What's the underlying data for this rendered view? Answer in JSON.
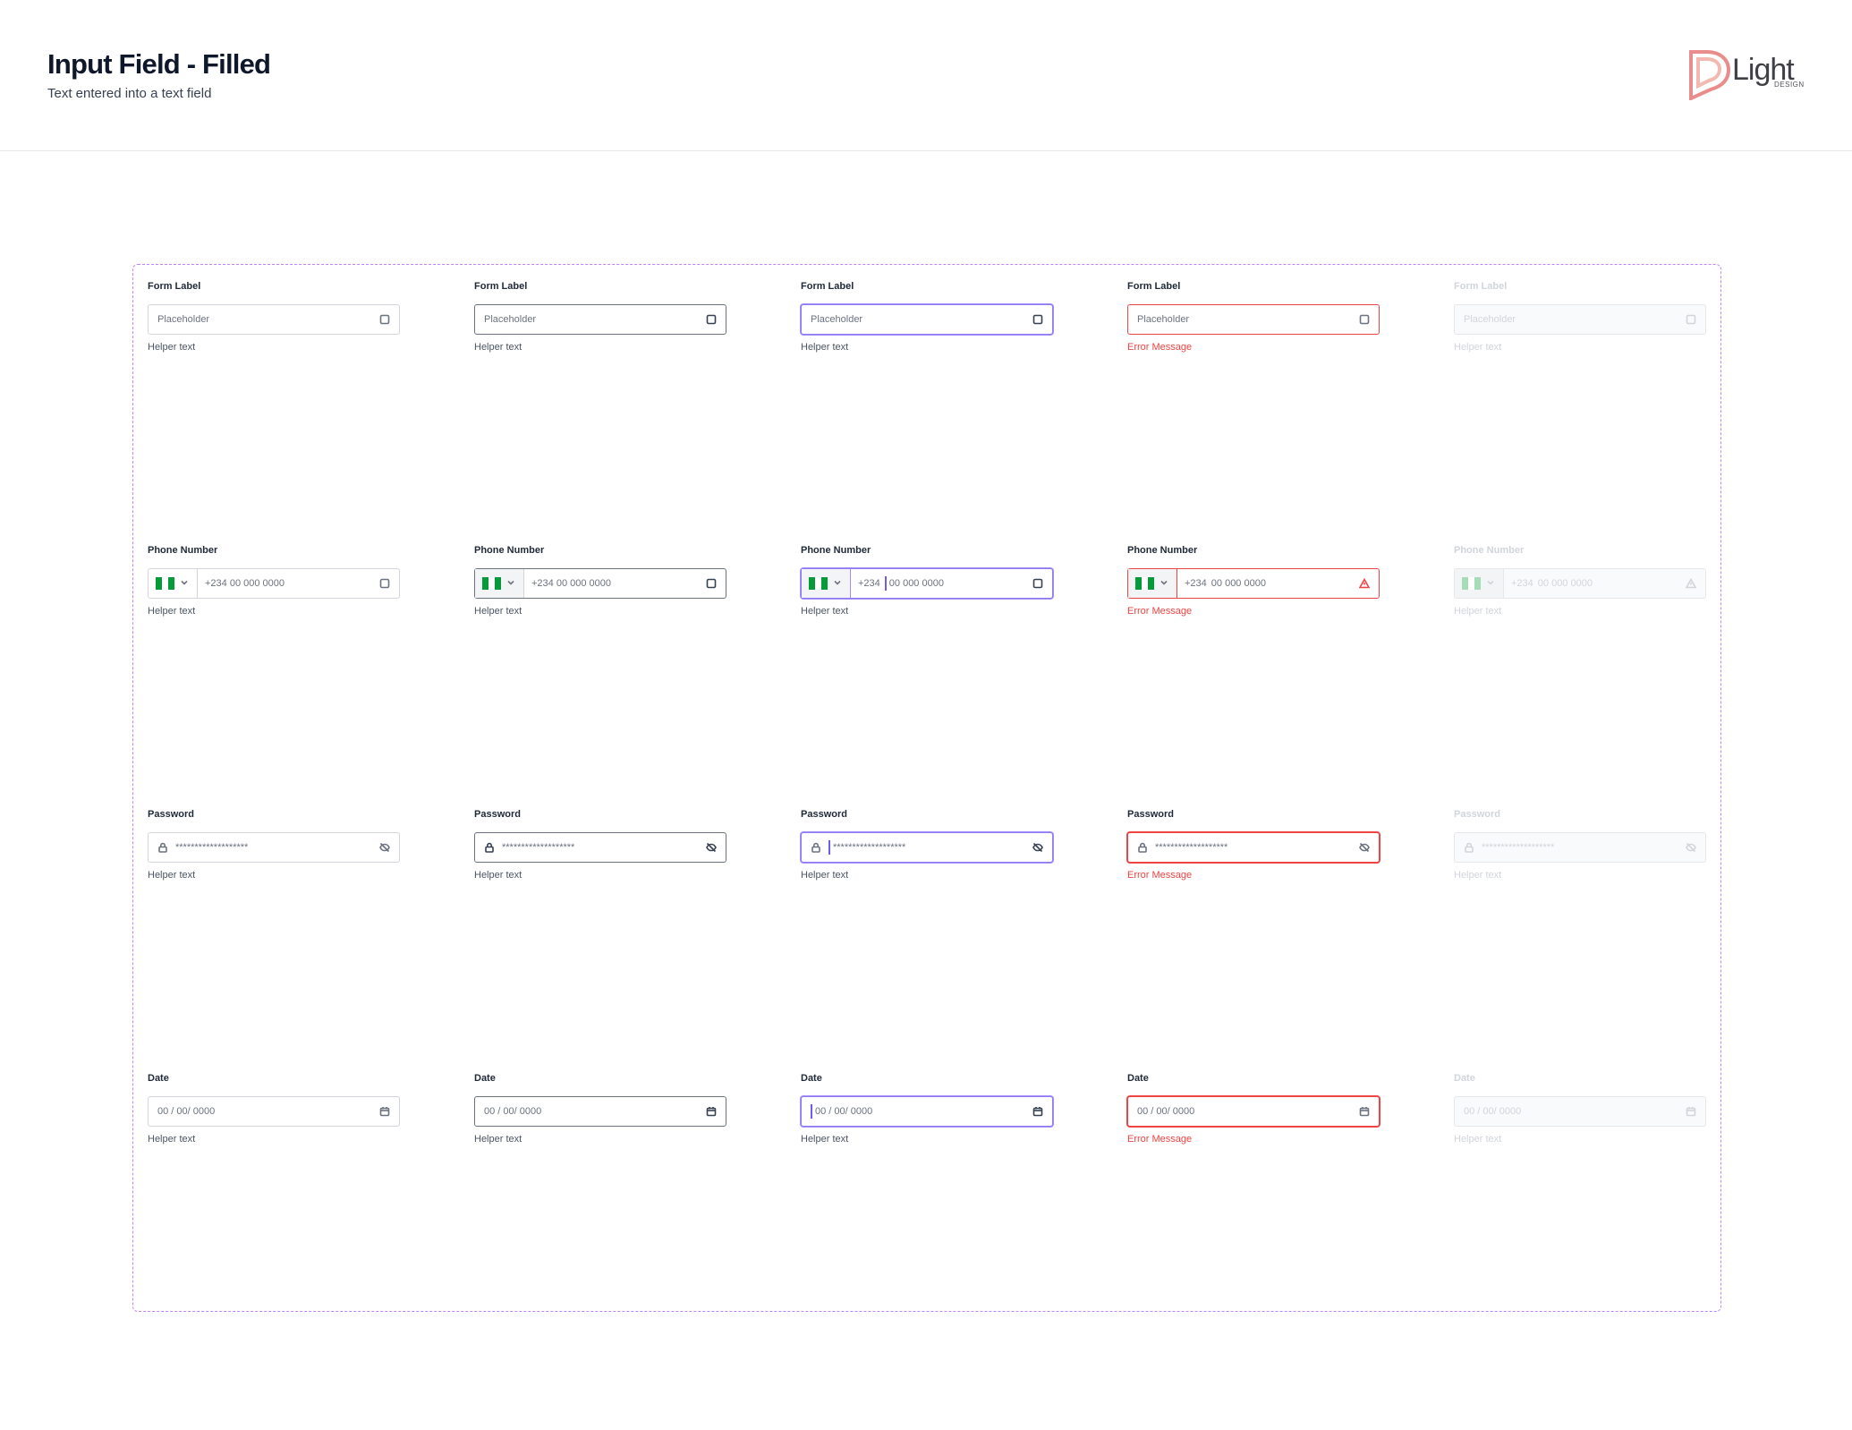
{
  "header": {
    "title": "Input Field - Filled",
    "subtitle": "Text entered into a text field"
  },
  "logo": {
    "word": "Light",
    "sub": "DESIGN",
    "colors": [
      "#e98c8c",
      "#f3b9b0"
    ]
  },
  "rows": {
    "text": {
      "label": "Form Label",
      "placeholder": "Placeholder",
      "helper": "Helper text",
      "error": "Error Message",
      "end_icon": "square-icon"
    },
    "phone": {
      "label": "Phone Number",
      "code": "+234",
      "number": "00 000 0000",
      "full": "+234 00 000 0000",
      "helper": "Helper text",
      "error": "Error Message",
      "flag_colors": [
        "#059b3b",
        "#ffffff",
        "#059b3b"
      ]
    },
    "password": {
      "label": "Password",
      "value": "*******************",
      "helper": "Helper text",
      "error": "Error Message",
      "start_icon": "lock-icon",
      "end_icon": "eye-off-icon"
    },
    "date": {
      "label": "Date",
      "value": "00 / 00/ 0000",
      "helper": "Helper text",
      "error": "Error Message",
      "end_icon": "calendar-icon"
    }
  },
  "colors": {
    "focus": "#8b7cf6",
    "error": "#ef4444",
    "hover": "#6b7280",
    "default": "#d1d5db",
    "frame": "#c084fc"
  }
}
